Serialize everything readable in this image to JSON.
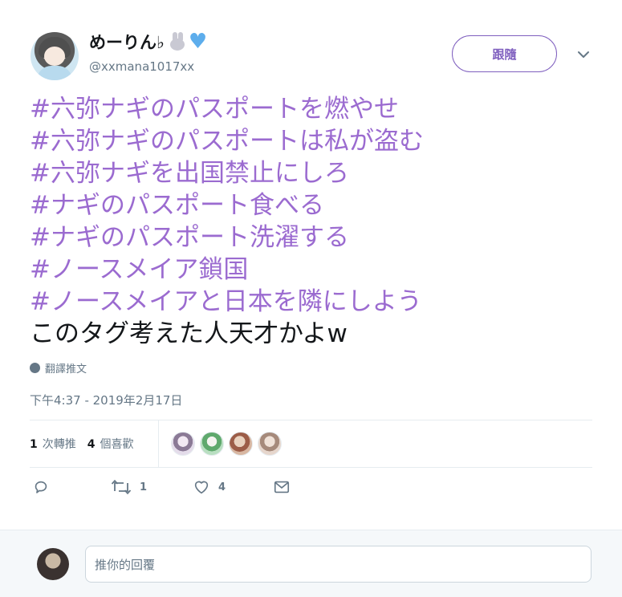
{
  "colors": {
    "accent": "#9b6bd0",
    "follow_border": "#7f5fbf",
    "text_primary": "#14171a",
    "text_secondary": "#657786",
    "heart_emoji": "#5dadec",
    "reply_bg": "#f5f8fa"
  },
  "author": {
    "display_name": "めーりん♭",
    "emoji_icons": [
      "rabbit-face-icon",
      "blue-heart-icon"
    ],
    "handle": "@xxmana1017xx",
    "avatar_icon": "user-avatar"
  },
  "follow_button": {
    "label": "跟隨"
  },
  "menu_icon": "chevron-down-icon",
  "tweet": {
    "lines": [
      {
        "text": "#六弥ナギのパスポートを燃やせ",
        "kind": "hashtag"
      },
      {
        "text": "#六弥ナギのパスポートは私が盗む",
        "kind": "hashtag"
      },
      {
        "text": "#六弥ナギを出国禁止にしろ",
        "kind": "hashtag"
      },
      {
        "text": "#ナギのパスポート食べる",
        "kind": "hashtag"
      },
      {
        "text": "#ナギのパスポート洗濯する",
        "kind": "hashtag"
      },
      {
        "text": "#ノースメイア鎖国",
        "kind": "hashtag"
      },
      {
        "text": "#ノースメイアと日本を隣にしよう",
        "kind": "hashtag"
      },
      {
        "text": "このタグ考えた人天才かよw",
        "kind": "plain"
      }
    ],
    "translate_label": "翻譯推文",
    "timestamp": "下午4:37 - 2019年2月17日"
  },
  "stats": {
    "retweets_count": "1",
    "retweets_label": "次轉推",
    "likes_count": "4",
    "likes_label": "個喜歡",
    "likers": [
      "#d8cfe0",
      "#8fc7a0",
      "#c9a591",
      "#d9c3b5"
    ]
  },
  "actions": {
    "reply_icon": "reply-icon",
    "retweet_icon": "retweet-icon",
    "retweet_count": "1",
    "like_icon": "heart-icon",
    "like_count": "4",
    "dm_icon": "envelope-icon"
  },
  "reply_box": {
    "placeholder": "推你的回覆"
  }
}
